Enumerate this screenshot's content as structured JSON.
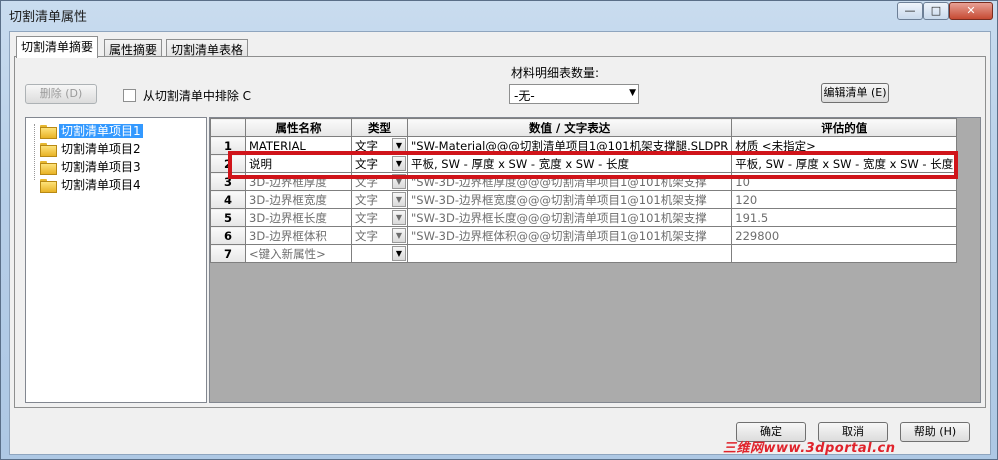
{
  "window": {
    "title": "切割清单属性",
    "controls": {
      "minimize": "—",
      "maximize": "□",
      "close": "✕"
    }
  },
  "tabs": [
    {
      "label": "切割清单摘要",
      "active": true
    },
    {
      "label": "属性摘要",
      "active": false
    },
    {
      "label": "切割清单表格",
      "active": false
    }
  ],
  "toolbar": {
    "delete_label": "删除 (D)",
    "exclude_label": "从切割清单中排除 C",
    "exclude_checked": false,
    "bom_qty_label": "材料明细表数量:",
    "bom_qty_value": "-无-",
    "edit_list_label": "编辑清单 (E)"
  },
  "tree": {
    "items": [
      {
        "label": "切割清单项目1",
        "selected": true,
        "icon": "folder-icon"
      },
      {
        "label": "切割清单项目2",
        "selected": false,
        "icon": "folder-icon"
      },
      {
        "label": "切割清单项目3",
        "selected": false,
        "icon": "folder-icon"
      },
      {
        "label": "切割清单项目4",
        "selected": false,
        "icon": "folder-icon"
      }
    ]
  },
  "grid": {
    "headers": [
      "属性名称",
      "类型",
      "数值 / 文字表达",
      "评估的值"
    ],
    "rows": [
      {
        "num": "1",
        "name": "MATERIAL",
        "type": "文字",
        "expr": "\"SW-Material@@@切割清单项目1@101机架支撑腿.SLDPR",
        "value": "材质 <未指定>"
      },
      {
        "num": "2",
        "name": "说明",
        "type": "文字",
        "expr": "平板, SW - 厚度 x SW - 宽度 x SW - 长度",
        "value": "平板, SW - 厚度 x SW - 宽度 x SW - 长度"
      },
      {
        "num": "3",
        "name": "3D-边界框厚度",
        "type": "文字",
        "expr": "\"SW-3D-边界框厚度@@@切割清单项目1@101机架支撑",
        "value": "10"
      },
      {
        "num": "4",
        "name": "3D-边界框宽度",
        "type": "文字",
        "expr": "\"SW-3D-边界框宽度@@@切割清单项目1@101机架支撑",
        "value": "120"
      },
      {
        "num": "5",
        "name": "3D-边界框长度",
        "type": "文字",
        "expr": "\"SW-3D-边界框长度@@@切割清单项目1@101机架支撑",
        "value": "191.5"
      },
      {
        "num": "6",
        "name": "3D-边界框体积",
        "type": "文字",
        "expr": "\"SW-3D-边界框体积@@@切割清单项目1@101机架支撑",
        "value": "229800"
      },
      {
        "num": "7",
        "name": "<键入新属性>",
        "type": "",
        "expr": "",
        "value": ""
      }
    ]
  },
  "buttons": {
    "ok": "确定",
    "cancel": "取消",
    "help": "帮助 (H)"
  },
  "watermark": "三维网www.3dportal.cn",
  "colors": {
    "highlight": "#d0141a",
    "selection": "#3399ff"
  }
}
